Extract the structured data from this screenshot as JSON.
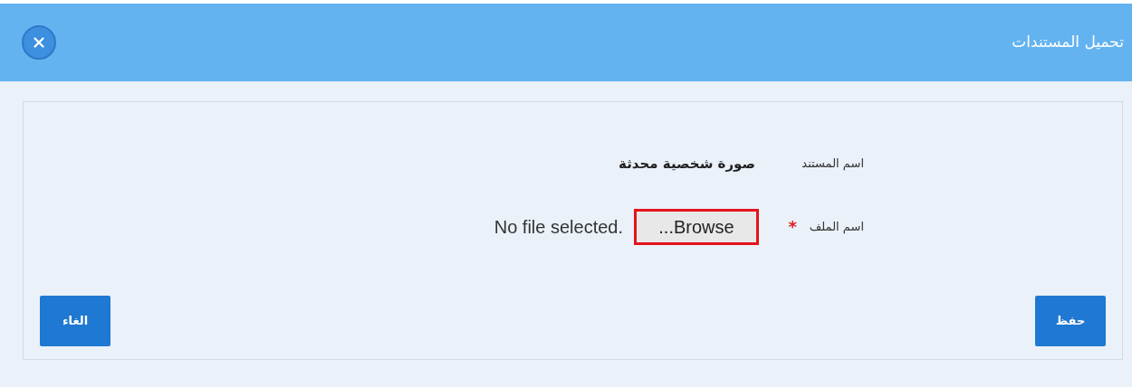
{
  "dialog": {
    "title": "تحميل المستندات"
  },
  "fields": [
    {
      "kind": "text",
      "label": "اسم المستند",
      "value": "صورة شخصية محدثة"
    },
    {
      "kind": "file",
      "label": "اسم الملف",
      "required": true,
      "required_mark": "*",
      "button": "...Browse",
      "highlighted": true,
      "status": "No file selected."
    }
  ],
  "buttons": [
    {
      "label": "حفظ"
    },
    {
      "label": "الغاء"
    }
  ]
}
